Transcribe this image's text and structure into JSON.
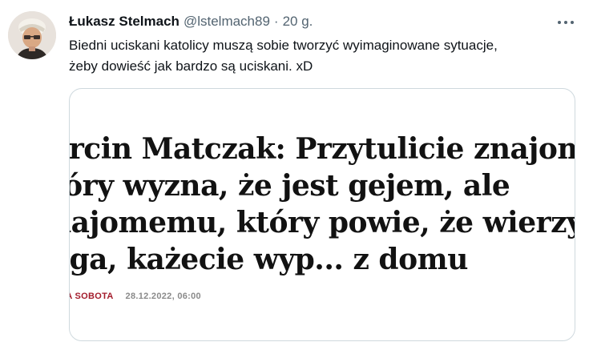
{
  "tweet": {
    "author_name": "Łukasz Stelmach",
    "author_handle": "@lstelmach89",
    "separator": "·",
    "time": "20 g.",
    "text_lines": [
      "Biedni uciskani katolicy muszą sobie tworzyć wyimaginowane sytuacje,",
      "żeby dowieść jak bardzo są uciskani. xD"
    ],
    "more_icon": "more-horizontal-icon"
  },
  "card": {
    "headline_lines": [
      "arcin Matczak: Przytulicie znajomego",
      "tóry wyzna, że jest gejem, ale",
      "najomemu, który powie, że wierzy w",
      "oga, każecie wyp... z domu"
    ],
    "source": "IA SOBOTA",
    "date": "28.12.2022, 06:00"
  },
  "colors": {
    "text": "#0f1419",
    "secondary": "#536471",
    "border": "#cfd9de",
    "source_red": "#a31b2b"
  }
}
